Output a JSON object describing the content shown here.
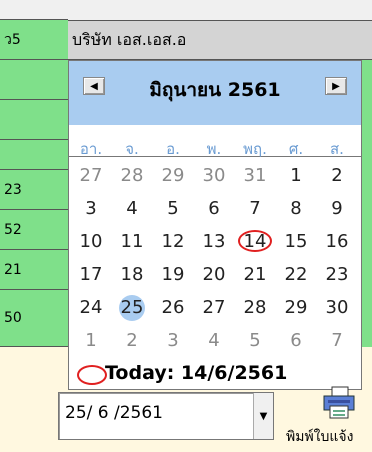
{
  "left_column": {
    "rows": [
      {
        "text": "ว5",
        "bg": "#7fe08a"
      },
      {
        "text": "",
        "bg": "#7fe08a"
      },
      {
        "text": "",
        "bg": "#7fe08a"
      },
      {
        "text": "",
        "bg": "#7fe08a"
      },
      {
        "text": "23",
        "bg": "#7fe08a"
      },
      {
        "text": "52",
        "bg": "#7fe08a"
      },
      {
        "text": "21",
        "bg": "#7fe08a"
      },
      {
        "text": "50",
        "bg": "#7fe08a"
      }
    ]
  },
  "sheet": {
    "company_cell": "บริษัท เอส.เอส.อ"
  },
  "calendar": {
    "prev_icon": "◀",
    "next_icon": "▶",
    "month_title": "มิถุนายน 2561",
    "weekday_headers": [
      "อา.",
      "จ.",
      "อ.",
      "พ.",
      "พฤ.",
      "ศ.",
      "ส."
    ],
    "weeks": [
      [
        {
          "d": "27",
          "o": true
        },
        {
          "d": "28",
          "o": true
        },
        {
          "d": "29",
          "o": true
        },
        {
          "d": "30",
          "o": true
        },
        {
          "d": "31",
          "o": true
        },
        {
          "d": "1"
        },
        {
          "d": "2"
        }
      ],
      [
        {
          "d": "3"
        },
        {
          "d": "4"
        },
        {
          "d": "5"
        },
        {
          "d": "6"
        },
        {
          "d": "7"
        },
        {
          "d": "8"
        },
        {
          "d": "9"
        }
      ],
      [
        {
          "d": "10"
        },
        {
          "d": "11"
        },
        {
          "d": "12"
        },
        {
          "d": "13"
        },
        {
          "d": "14",
          "today": true
        },
        {
          "d": "15"
        },
        {
          "d": "16"
        }
      ],
      [
        {
          "d": "17"
        },
        {
          "d": "18"
        },
        {
          "d": "19"
        },
        {
          "d": "20"
        },
        {
          "d": "21"
        },
        {
          "d": "22"
        },
        {
          "d": "23"
        }
      ],
      [
        {
          "d": "24"
        },
        {
          "d": "25",
          "selected": true
        },
        {
          "d": "26"
        },
        {
          "d": "27"
        },
        {
          "d": "28"
        },
        {
          "d": "29"
        },
        {
          "d": "30"
        }
      ],
      [
        {
          "d": "1",
          "o": true
        },
        {
          "d": "2",
          "o": true
        },
        {
          "d": "3",
          "o": true
        },
        {
          "d": "4",
          "o": true
        },
        {
          "d": "5",
          "o": true
        },
        {
          "d": "6",
          "o": true
        },
        {
          "d": "7",
          "o": true
        }
      ]
    ],
    "today_label": "Today: 14/6/2561",
    "colors": {
      "header_bg": "#a9ccf0",
      "selected": "#a9ccf0",
      "today_ring": "#e02020",
      "weekday": "#6a9bd2"
    }
  },
  "date_picker": {
    "value": "25/ 6 /2561",
    "dropdown_icon": "▼"
  },
  "print_button": {
    "label": "พิมพ์ใบแจ้ง",
    "icon": "printer-icon"
  }
}
